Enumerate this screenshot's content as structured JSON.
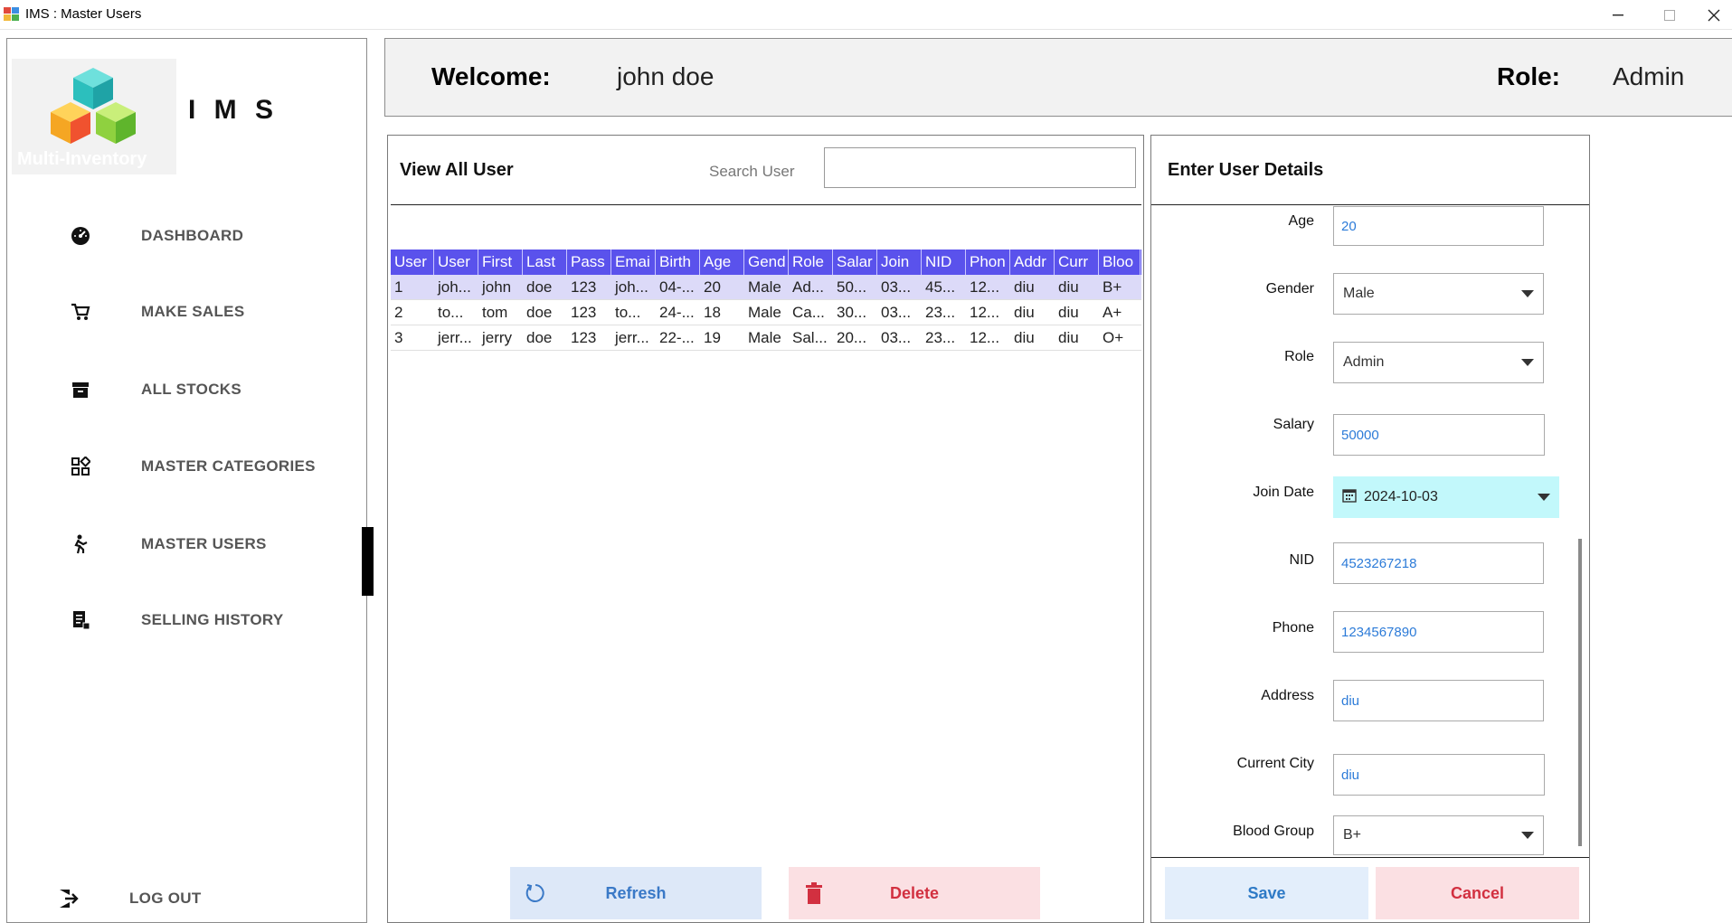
{
  "window": {
    "title": "IMS : Master Users"
  },
  "sidebar": {
    "app_name": "I M S",
    "logo_caption": "Multi-Inventory",
    "items": [
      {
        "label": "DASHBOARD",
        "icon": "dashboard-gauge-icon"
      },
      {
        "label": "MAKE SALES",
        "icon": "cart-icon"
      },
      {
        "label": "ALL STOCKS",
        "icon": "archive-box-icon"
      },
      {
        "label": "MASTER CATEGORIES",
        "icon": "categories-grid-icon"
      },
      {
        "label": "MASTER USERS",
        "icon": "user-walking-icon"
      },
      {
        "label": "SELLING HISTORY",
        "icon": "receipt-icon"
      }
    ],
    "logout_label": "LOG OUT"
  },
  "header": {
    "welcome_label": "Welcome:",
    "user_name": "john doe",
    "role_label": "Role:",
    "role_value": "Admin"
  },
  "users_list": {
    "title": "View All User",
    "search_label": "Search User",
    "search_value": "",
    "columns": [
      "User",
      "User",
      "First",
      "Last",
      "Pass",
      "Emai",
      "Birth",
      "Age",
      "Gend",
      "Role",
      "Salar",
      "Join",
      "NID",
      "Phon",
      "Addr",
      "Curr",
      "Bloo"
    ],
    "rows": [
      [
        "1",
        "joh...",
        "john",
        "doe",
        "123",
        "joh...",
        "04-...",
        "20",
        "Male",
        "Ad...",
        "50...",
        "03...",
        "45...",
        "12...",
        "diu",
        "diu",
        "B+"
      ],
      [
        "2",
        "to...",
        "tom",
        "doe",
        "123",
        "to...",
        "24-...",
        "18",
        "Male",
        "Ca...",
        "30...",
        "03...",
        "23...",
        "12...",
        "diu",
        "diu",
        "A+"
      ],
      [
        "3",
        "jerr...",
        "jerry",
        "doe",
        "123",
        "jerr...",
        "22-...",
        "19",
        "Male",
        "Sal...",
        "20...",
        "03...",
        "23...",
        "12...",
        "diu",
        "diu",
        "O+"
      ]
    ],
    "refresh_label": "Refresh",
    "delete_label": "Delete"
  },
  "details": {
    "title": "Enter User Details",
    "age_label": "Age",
    "age_value": "20",
    "gender_label": "Gender",
    "gender_value": "Male",
    "role_label": "Role",
    "role_value": "Admin",
    "salary_label": "Salary",
    "salary_value": "50000",
    "join_label": "Join Date",
    "join_value": "2024-10-03",
    "nid_label": "NID",
    "nid_value": "4523267218",
    "phone_label": "Phone",
    "phone_value": "1234567890",
    "address_label": "Address",
    "address_value": "diu",
    "city_label": "Current City",
    "city_value": "diu",
    "blood_label": "Blood Group",
    "blood_value": "B+",
    "save_label": "Save",
    "cancel_label": "Cancel"
  },
  "colors": {
    "grid_header": "#5a52ec",
    "grid_selected": "#dcdaf8",
    "date_picker": "#c2f8fb",
    "refresh_text": "#3a79c7",
    "delete_text": "#d23040"
  }
}
